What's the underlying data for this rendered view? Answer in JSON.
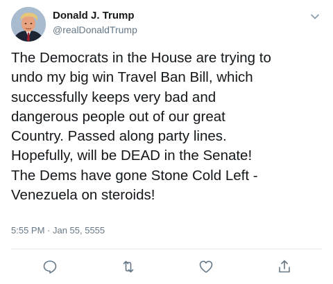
{
  "user": {
    "display_name": "Donald J. Trump",
    "handle": "@realDonaldTrump"
  },
  "tweet": {
    "text": "The Democrats in the House are trying to\nundo my big win Travel Ban Bill, which\nsuccessfully keeps very bad and\ndangerous people out of our great\nCountry. Passed along party lines.\nHopefully, will be DEAD in the Senate!\nThe Dems have gone Stone Cold Left -\nVenezuela on steroids!",
    "timestamp": "5:55 PM · Jan 55, 5555"
  },
  "icons": {
    "avatar": "profile-photo",
    "menu": "chevron-down-icon",
    "reply": "comment-icon",
    "retweet": "retweet-icon",
    "like": "heart-icon",
    "share": "share-icon"
  },
  "colors": {
    "text": "#14171a",
    "secondary": "#657786",
    "divider": "#e1e8ed"
  }
}
